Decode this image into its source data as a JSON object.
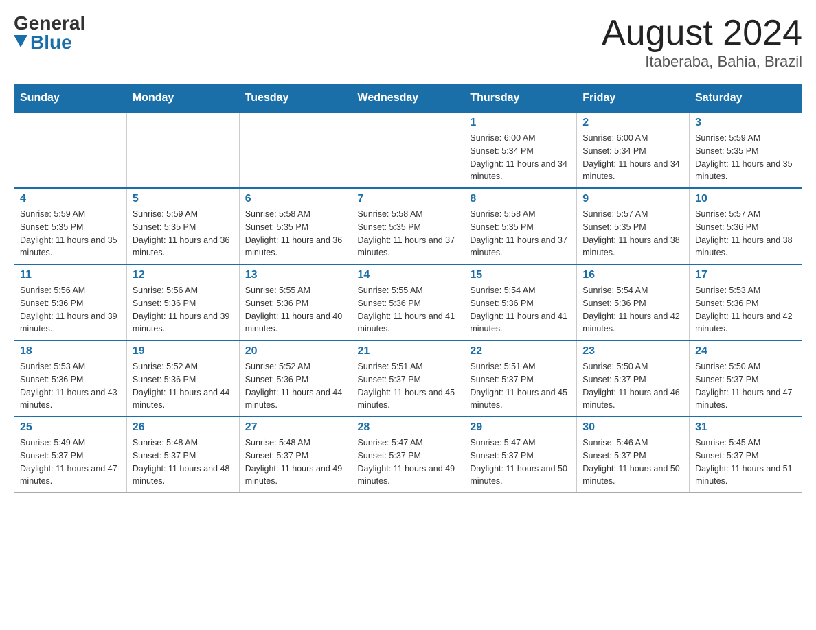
{
  "logo": {
    "general": "General",
    "blue": "Blue"
  },
  "header": {
    "month": "August 2024",
    "location": "Itaberaba, Bahia, Brazil"
  },
  "weekdays": [
    "Sunday",
    "Monday",
    "Tuesday",
    "Wednesday",
    "Thursday",
    "Friday",
    "Saturday"
  ],
  "weeks": [
    [
      {
        "day": "",
        "info": ""
      },
      {
        "day": "",
        "info": ""
      },
      {
        "day": "",
        "info": ""
      },
      {
        "day": "",
        "info": ""
      },
      {
        "day": "1",
        "info": "Sunrise: 6:00 AM\nSunset: 5:34 PM\nDaylight: 11 hours and 34 minutes."
      },
      {
        "day": "2",
        "info": "Sunrise: 6:00 AM\nSunset: 5:34 PM\nDaylight: 11 hours and 34 minutes."
      },
      {
        "day": "3",
        "info": "Sunrise: 5:59 AM\nSunset: 5:35 PM\nDaylight: 11 hours and 35 minutes."
      }
    ],
    [
      {
        "day": "4",
        "info": "Sunrise: 5:59 AM\nSunset: 5:35 PM\nDaylight: 11 hours and 35 minutes."
      },
      {
        "day": "5",
        "info": "Sunrise: 5:59 AM\nSunset: 5:35 PM\nDaylight: 11 hours and 36 minutes."
      },
      {
        "day": "6",
        "info": "Sunrise: 5:58 AM\nSunset: 5:35 PM\nDaylight: 11 hours and 36 minutes."
      },
      {
        "day": "7",
        "info": "Sunrise: 5:58 AM\nSunset: 5:35 PM\nDaylight: 11 hours and 37 minutes."
      },
      {
        "day": "8",
        "info": "Sunrise: 5:58 AM\nSunset: 5:35 PM\nDaylight: 11 hours and 37 minutes."
      },
      {
        "day": "9",
        "info": "Sunrise: 5:57 AM\nSunset: 5:35 PM\nDaylight: 11 hours and 38 minutes."
      },
      {
        "day": "10",
        "info": "Sunrise: 5:57 AM\nSunset: 5:36 PM\nDaylight: 11 hours and 38 minutes."
      }
    ],
    [
      {
        "day": "11",
        "info": "Sunrise: 5:56 AM\nSunset: 5:36 PM\nDaylight: 11 hours and 39 minutes."
      },
      {
        "day": "12",
        "info": "Sunrise: 5:56 AM\nSunset: 5:36 PM\nDaylight: 11 hours and 39 minutes."
      },
      {
        "day": "13",
        "info": "Sunrise: 5:55 AM\nSunset: 5:36 PM\nDaylight: 11 hours and 40 minutes."
      },
      {
        "day": "14",
        "info": "Sunrise: 5:55 AM\nSunset: 5:36 PM\nDaylight: 11 hours and 41 minutes."
      },
      {
        "day": "15",
        "info": "Sunrise: 5:54 AM\nSunset: 5:36 PM\nDaylight: 11 hours and 41 minutes."
      },
      {
        "day": "16",
        "info": "Sunrise: 5:54 AM\nSunset: 5:36 PM\nDaylight: 11 hours and 42 minutes."
      },
      {
        "day": "17",
        "info": "Sunrise: 5:53 AM\nSunset: 5:36 PM\nDaylight: 11 hours and 42 minutes."
      }
    ],
    [
      {
        "day": "18",
        "info": "Sunrise: 5:53 AM\nSunset: 5:36 PM\nDaylight: 11 hours and 43 minutes."
      },
      {
        "day": "19",
        "info": "Sunrise: 5:52 AM\nSunset: 5:36 PM\nDaylight: 11 hours and 44 minutes."
      },
      {
        "day": "20",
        "info": "Sunrise: 5:52 AM\nSunset: 5:36 PM\nDaylight: 11 hours and 44 minutes."
      },
      {
        "day": "21",
        "info": "Sunrise: 5:51 AM\nSunset: 5:37 PM\nDaylight: 11 hours and 45 minutes."
      },
      {
        "day": "22",
        "info": "Sunrise: 5:51 AM\nSunset: 5:37 PM\nDaylight: 11 hours and 45 minutes."
      },
      {
        "day": "23",
        "info": "Sunrise: 5:50 AM\nSunset: 5:37 PM\nDaylight: 11 hours and 46 minutes."
      },
      {
        "day": "24",
        "info": "Sunrise: 5:50 AM\nSunset: 5:37 PM\nDaylight: 11 hours and 47 minutes."
      }
    ],
    [
      {
        "day": "25",
        "info": "Sunrise: 5:49 AM\nSunset: 5:37 PM\nDaylight: 11 hours and 47 minutes."
      },
      {
        "day": "26",
        "info": "Sunrise: 5:48 AM\nSunset: 5:37 PM\nDaylight: 11 hours and 48 minutes."
      },
      {
        "day": "27",
        "info": "Sunrise: 5:48 AM\nSunset: 5:37 PM\nDaylight: 11 hours and 49 minutes."
      },
      {
        "day": "28",
        "info": "Sunrise: 5:47 AM\nSunset: 5:37 PM\nDaylight: 11 hours and 49 minutes."
      },
      {
        "day": "29",
        "info": "Sunrise: 5:47 AM\nSunset: 5:37 PM\nDaylight: 11 hours and 50 minutes."
      },
      {
        "day": "30",
        "info": "Sunrise: 5:46 AM\nSunset: 5:37 PM\nDaylight: 11 hours and 50 minutes."
      },
      {
        "day": "31",
        "info": "Sunrise: 5:45 AM\nSunset: 5:37 PM\nDaylight: 11 hours and 51 minutes."
      }
    ]
  ]
}
